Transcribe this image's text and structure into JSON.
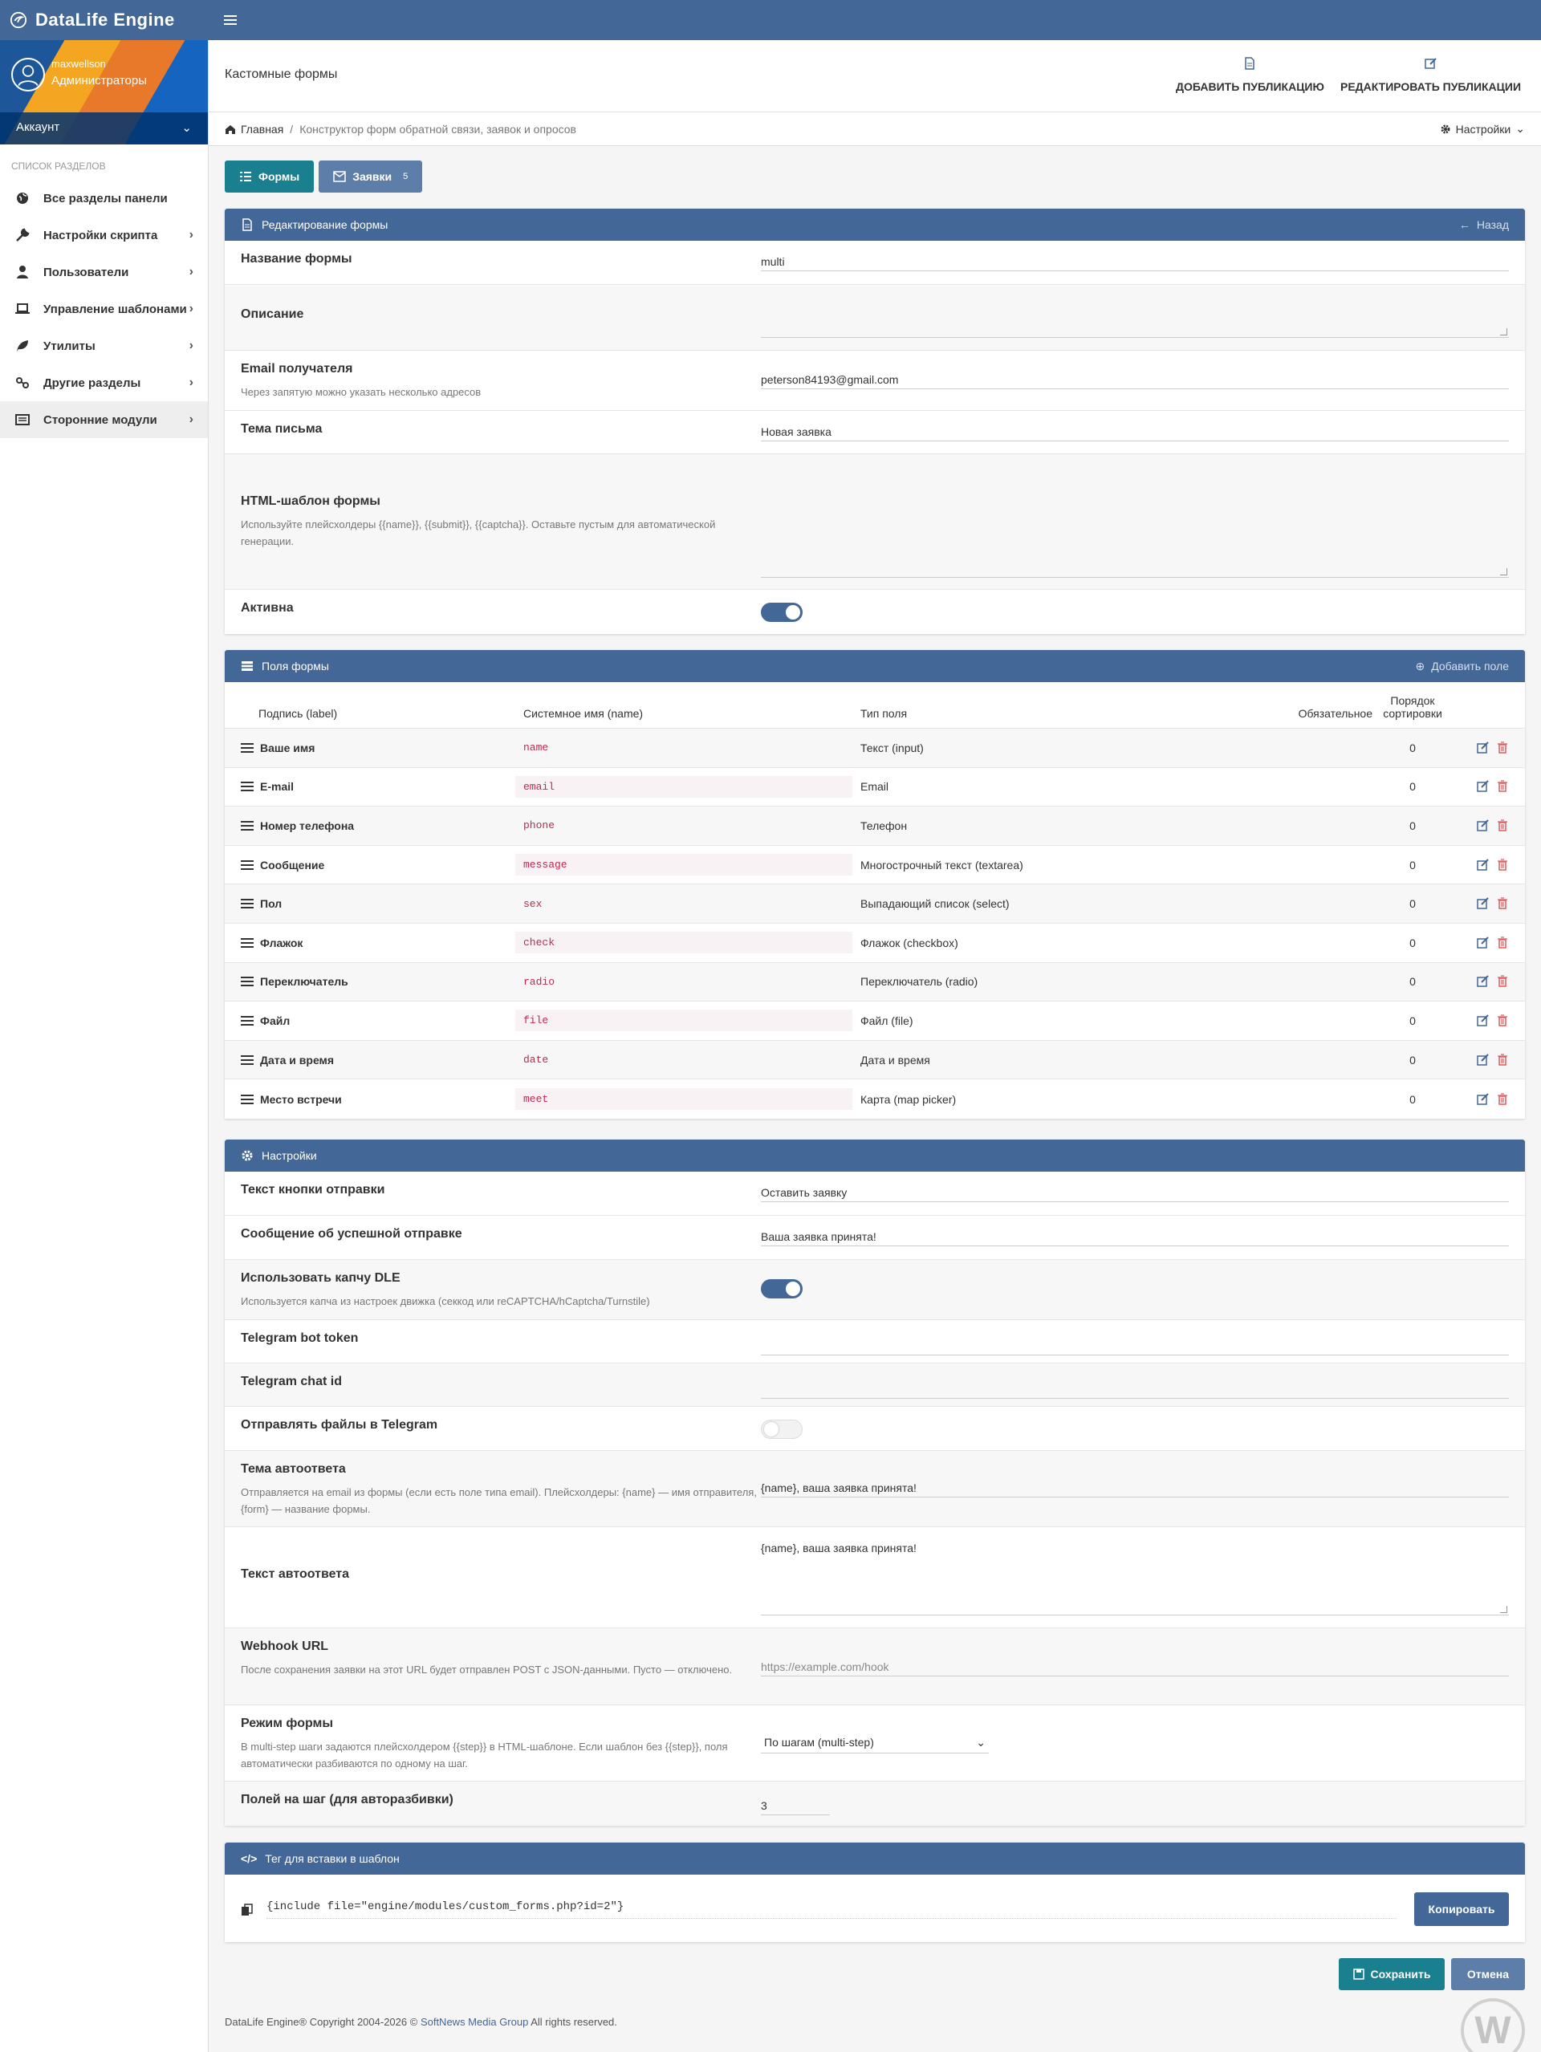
{
  "app": {
    "title": "DataLife Engine"
  },
  "sidebar": {
    "user": {
      "name": "maxwellson",
      "group": "Администраторы",
      "account": "Аккаунт"
    },
    "section_label": "Список разделов",
    "items": [
      {
        "label": "Все разделы панели",
        "icon": "globe-icon"
      },
      {
        "label": "Настройки скрипта",
        "icon": "wrench-icon"
      },
      {
        "label": "Пользователи",
        "icon": "user-icon"
      },
      {
        "label": "Управление шаблонами",
        "icon": "laptop-icon"
      },
      {
        "label": "Утилиты",
        "icon": "leaf-icon"
      },
      {
        "label": "Другие разделы",
        "icon": "link-icon"
      },
      {
        "label": "Сторонние модули",
        "icon": "list-icon"
      }
    ]
  },
  "header": {
    "title": "Кастомные формы",
    "add_pub": "ДОБАВИТЬ ПУБЛИКАЦИЮ",
    "edit_pub": "РЕДАКТИРОВАТЬ ПУБЛИКАЦИИ"
  },
  "breadcrumb": {
    "home": "Главная",
    "current": "Конструктор форм обратной связи, заявок и опросов",
    "settings": "Настройки"
  },
  "tabs": {
    "forms": "Формы",
    "requests": "Заявки",
    "requests_count": "5"
  },
  "edit_panel": {
    "title": "Редактирование формы",
    "back": "Назад",
    "name_label": "Название формы",
    "name_value": "multi",
    "desc_label": "Описание",
    "email_label": "Email получателя",
    "email_hint": "Через запятую можно указать несколько адресов",
    "email_value": "peterson84193@gmail.com",
    "subject_label": "Тема письма",
    "subject_value": "Новая заявка",
    "html_label": "HTML-шаблон формы",
    "html_hint": "Используйте плейсхолдеры {{name}}, {{submit}}, {{captcha}}. Оставьте пустым для автоматической генерации.",
    "active_label": "Активна"
  },
  "fields_panel": {
    "title": "Поля формы",
    "add": "Добавить поле",
    "headers": {
      "label": "Подпись (label)",
      "name": "Системное имя (name)",
      "type": "Тип поля",
      "required": "Обязательное",
      "sort1": "Порядок",
      "sort2": "сортировки"
    },
    "rows": [
      {
        "label": "Ваше имя",
        "name": "name",
        "type": "Текст (input)",
        "sort": "0"
      },
      {
        "label": "E-mail",
        "name": "email",
        "type": "Email",
        "sort": "0"
      },
      {
        "label": "Номер телефона",
        "name": "phone",
        "type": "Телефон",
        "sort": "0"
      },
      {
        "label": "Сообщение",
        "name": "message",
        "type": "Многострочный текст (textarea)",
        "sort": "0"
      },
      {
        "label": "Пол",
        "name": "sex",
        "type": "Выпадающий список (select)",
        "sort": "0"
      },
      {
        "label": "Флажок",
        "name": "check",
        "type": "Флажок (checkbox)",
        "sort": "0"
      },
      {
        "label": "Переключатель",
        "name": "radio",
        "type": "Переключатель (radio)",
        "sort": "0"
      },
      {
        "label": "Файл",
        "name": "file",
        "type": "Файл (file)",
        "sort": "0"
      },
      {
        "label": "Дата и время",
        "name": "date",
        "type": "Дата и время",
        "sort": "0"
      },
      {
        "label": "Место встречи",
        "name": "meet",
        "type": "Карта (map picker)",
        "sort": "0"
      }
    ]
  },
  "settings_panel": {
    "title": "Настройки",
    "btn_label": "Текст кнопки отправки",
    "btn_value": "Оставить заявку",
    "success_label": "Сообщение об успешной отправке",
    "success_value": "Ваша заявка принята!",
    "captcha_label": "Использовать капчу DLE",
    "captcha_hint": "Используется капча из настроек движка (секкод или reCAPTCHA/hCaptcha/Turnstile)",
    "tg_token_label": "Telegram bot token",
    "tg_chat_label": "Telegram chat id",
    "tg_files_label": "Отправлять файлы в Telegram",
    "auto_subj_label": "Тема автоответа",
    "auto_subj_hint": "Отправляется на email из формы (если есть поле типа email). Плейсхолдеры: {name} — имя отправителя, {form} — название формы.",
    "auto_subj_value": "{name},  ваша заявка принята!",
    "auto_text_label": "Текст автоответа",
    "auto_text_value": "{name},  ваша заявка принята!",
    "webhook_label": "Webhook URL",
    "webhook_hint": "После сохранения заявки на этот URL будет отправлен POST с JSON-данными. Пусто — отключено.",
    "webhook_placeholder": "https://example.com/hook",
    "mode_label": "Режим формы",
    "mode_hint": "В multi-step шаги задаются плейсхолдером {{step}} в HTML-шаблоне. Если шаблон без {{step}}, поля автоматически разбиваются по одному на шаг.",
    "mode_value": "По шагам (multi-step)",
    "perstep_label": "Полей на шаг (для авторазбивки)",
    "perstep_value": "3"
  },
  "tag_panel": {
    "title": "Тег для вставки в шаблон",
    "code": "{include file=\"engine/modules/custom_forms.php?id=2\"}",
    "copy": "Копировать"
  },
  "actions": {
    "save": "Сохранить",
    "cancel": "Отмена"
  },
  "footer": {
    "prefix": "DataLife Engine® Copyright 2004-2026 ©",
    "link": "SoftNews Media Group",
    "suffix": "All rights reserved."
  },
  "colors": {
    "primary": "#436797",
    "accent": "#1a7f8e",
    "danger": "#e05c5c",
    "code": "#c7254e"
  }
}
